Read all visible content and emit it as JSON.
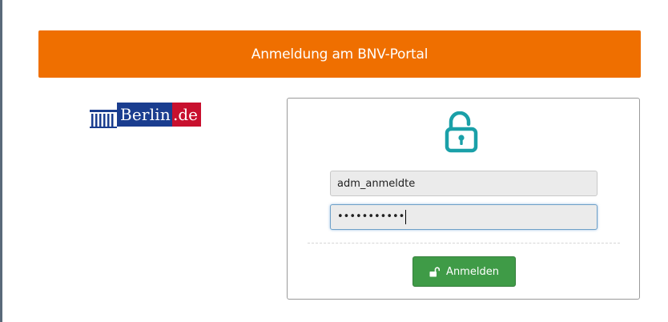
{
  "header": {
    "title": "Anmeldung am BNV-Portal",
    "background": "#ef6f00"
  },
  "logo": {
    "text_main": "Berlin",
    "text_suffix": ".de",
    "brand_blue": "#1a3d8f",
    "brand_red": "#c8102e"
  },
  "login": {
    "icon": "unlocked-padlock-icon",
    "icon_color": "#1aa0a8",
    "username_value": "adm_anmeldte",
    "password_masked": "•••••••••••",
    "button_label": "Anmelden",
    "button_icon": "unlock-icon",
    "button_color": "#3f9b47"
  }
}
